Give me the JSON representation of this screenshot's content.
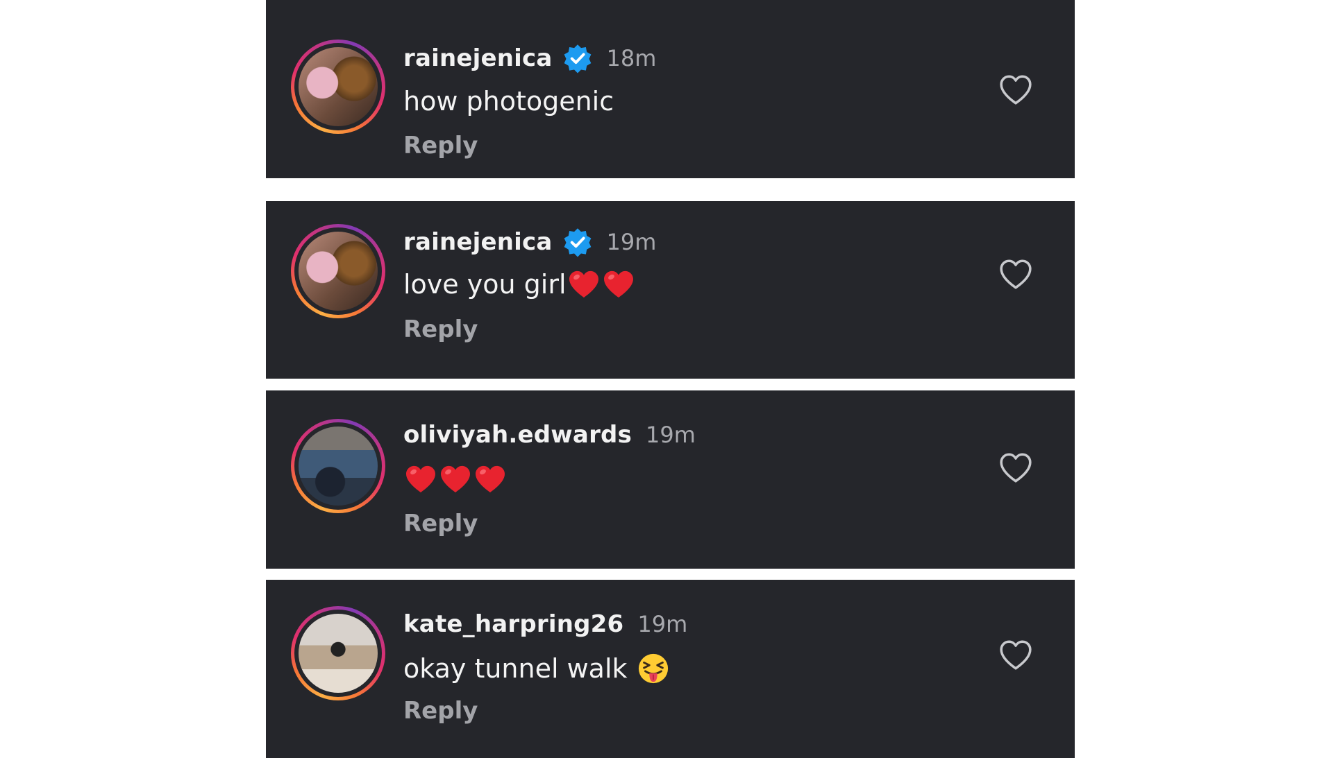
{
  "comments": [
    {
      "username": "rainejenica",
      "verified": true,
      "time": "18m",
      "text": "how photogenic",
      "emojis": [],
      "reply_label": "Reply",
      "avatar_icon": "avatar-photo",
      "like_icon": "heart-outline-icon"
    },
    {
      "username": "rainejenica",
      "verified": true,
      "time": "19m",
      "text": "love you girl",
      "emojis": [
        "red-heart",
        "red-heart"
      ],
      "reply_label": "Reply",
      "avatar_icon": "avatar-photo",
      "like_icon": "heart-outline-icon"
    },
    {
      "username": "oliviyah.edwards",
      "verified": false,
      "time": "19m",
      "text": "",
      "emojis": [
        "red-heart",
        "red-heart",
        "red-heart"
      ],
      "reply_label": "Reply",
      "avatar_icon": "avatar-photo",
      "like_icon": "heart-outline-icon"
    },
    {
      "username": "kate_harpring26",
      "verified": false,
      "time": "19m",
      "text": "okay tunnel walk",
      "emojis": [
        "squinting-face-with-tongue"
      ],
      "reply_label": "Reply",
      "avatar_icon": "avatar-photo",
      "like_icon": "heart-outline-icon"
    }
  ],
  "colors": {
    "card_background": "#25262b",
    "page_background": "#ffffff",
    "verified_blue": "#1d9bf0",
    "heart_red": "#e8232f"
  }
}
